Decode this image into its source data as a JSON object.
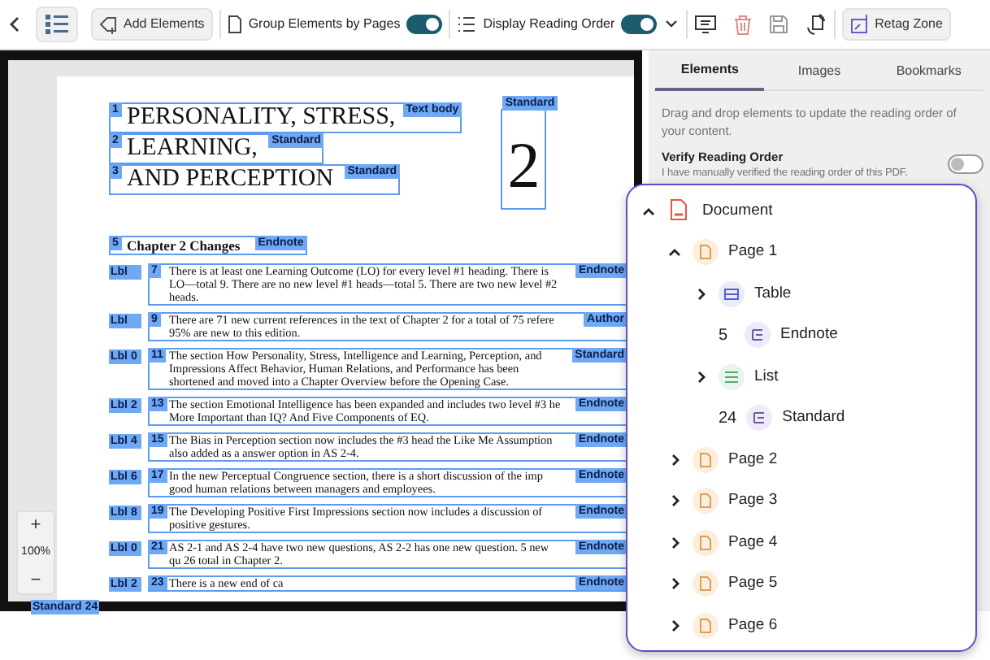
{
  "toolbar": {
    "add_elements": "Add Elements",
    "group_by_pages": {
      "label": "Group Elements by Pages",
      "on": true
    },
    "display_reading_order": {
      "label": "Display Reading Order",
      "on": true
    },
    "retag_zone": "Retag Zone"
  },
  "document": {
    "headings": [
      {
        "number": "1",
        "tag": "Text body",
        "text": "PERSONALITY, STRESS,"
      },
      {
        "number": "2",
        "tag": "Standard",
        "text": "LEARNING,"
      },
      {
        "number": "3",
        "tag": "Standard",
        "text": "AND PERCEPTION"
      }
    ],
    "figure": {
      "tag": "Standard",
      "text": "2"
    },
    "section": {
      "number": "5",
      "tag": "Endnote",
      "text": "Chapter 2 Changes"
    },
    "items": [
      {
        "label": "Lbl",
        "number": "7",
        "tag": "Endnote",
        "text": "There is at least one Learning Outcome (LO) for every level #1 heading. There is LO—total 9. There are no new level #1 heads—total 5. There are two new level #2 heads."
      },
      {
        "label": "Lbl",
        "number": "9",
        "tag": "Author",
        "text": "There are 71 new current references in the text of Chapter 2 for a total of 75 refere 95% are new to this edition."
      },
      {
        "label": "Lbl 0",
        "number": "11",
        "tag": "Standard",
        "text": "The section How Personality, Stress, Intelligence and Learning, Perception, and Impressions Affect Behavior, Human Relations, and Performance has been shortened and moved into a Chapter Overview before the Opening Case."
      },
      {
        "label": "Lbl 2",
        "number": "13",
        "tag": "Endnote",
        "text": "The section Emotional Intelligence has been expanded and includes two level #3 he More Important than IQ? And Five Components of EQ."
      },
      {
        "label": "Lbl 4",
        "number": "15",
        "tag": "Endnote",
        "text": "The Bias in Perception section now includes the #3 head the Like Me Assumption also added as a answer option in AS 2-4."
      },
      {
        "label": "Lbl 6",
        "number": "17",
        "tag": "Endnote",
        "text": "In the new Perceptual Congruence section, there is a short discussion of the imp good human relations between managers and employees."
      },
      {
        "label": "Lbl 8",
        "number": "19",
        "tag": "Endnote",
        "text": "The Developing Positive First Impressions section now includes a discussion of positive gestures."
      },
      {
        "label": "Lbl 0",
        "number": "21",
        "tag": "Endnote",
        "text": "AS 2-1 and AS 2-4 have two new questions, AS 2-2 has one new question. 5 new qu 26 total in Chapter 2."
      },
      {
        "label": "Lbl 2",
        "number": "23",
        "tag": "Endnote",
        "text": "There is a new end of ca"
      }
    ],
    "trailing": {
      "tag": "Standard",
      "number": "24"
    }
  },
  "zoom": {
    "level_text": "100%",
    "zoom_in": "+",
    "zoom_out": "−"
  },
  "sidebar": {
    "tabs": [
      {
        "label": "Elements",
        "selected": true
      },
      {
        "label": "Images",
        "selected": false
      },
      {
        "label": "Bookmarks",
        "selected": false
      }
    ],
    "description": "Drag and drop elements to update the reading order of your content.",
    "verify": {
      "title": "Verify Reading Order",
      "description": "I have manually verified the reading order of this PDF.",
      "on": false
    }
  },
  "tree": [
    {
      "label": "Document",
      "kind": "document",
      "expanded": true,
      "children": [
        {
          "label": "Page 1",
          "kind": "page",
          "expanded": true,
          "children": [
            {
              "label": "Table",
              "kind": "table",
              "expanded": false
            },
            {
              "label": "Endnote",
              "kind": "note",
              "count": "5"
            },
            {
              "label": "List",
              "kind": "list",
              "expanded": false
            },
            {
              "label": "Standard",
              "kind": "note",
              "count": "24"
            }
          ]
        },
        {
          "label": "Page 2",
          "kind": "page",
          "expanded": false
        },
        {
          "label": "Page 3",
          "kind": "page",
          "expanded": false
        },
        {
          "label": "Page 4",
          "kind": "page",
          "expanded": false
        },
        {
          "label": "Page 5",
          "kind": "page",
          "expanded": false
        },
        {
          "label": "Page 6",
          "kind": "page",
          "expanded": false
        }
      ]
    }
  ]
}
